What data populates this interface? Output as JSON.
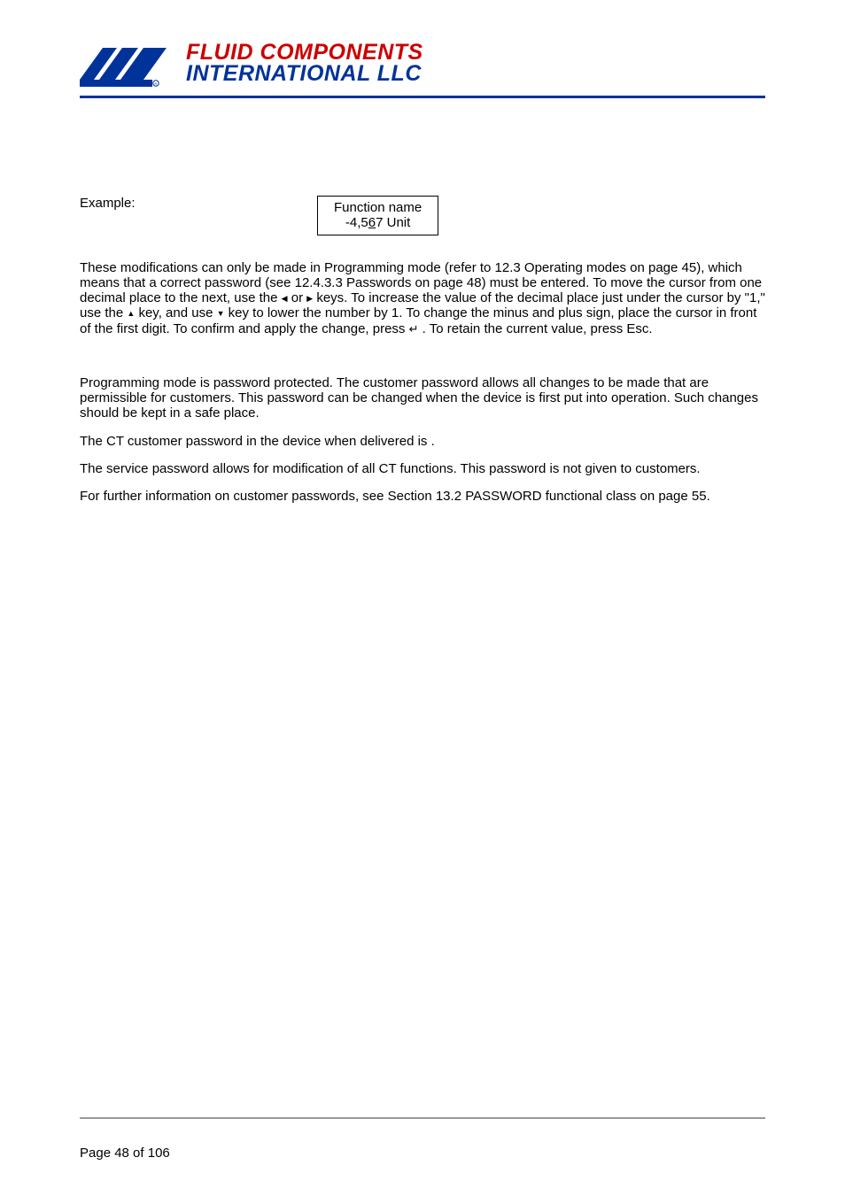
{
  "logo": {
    "line1": "FLUID COMPONENTS",
    "line2": "INTERNATIONAL LLC"
  },
  "example_label": "Example:",
  "box": {
    "line1": "Function name",
    "prefix": "-4,5",
    "under": "6",
    "suffix": "7 Unit"
  },
  "p1a": "These modifications can only be made in Programming mode (refer to 12.3 Operating modes on page 45), which means that a correct password (see 12.4.3.3 Passwords on page 48) must be entered. To move the cursor from one decimal place to the next, use the ",
  "p1b": " or ",
  "p1c": " keys. To increase the value of the decimal place just under the cursor by \"1,\" use the ",
  "p1d": " key, and use ",
  "p1e": " key to lower the number by 1. To change the minus and plus sign, place the cursor in front of the first digit. To confirm and apply the change, press ",
  "p1f": " . To retain the current value, press Esc.",
  "p2": "Programming mode is password protected. The customer password allows all changes to be made that are permissible for customers. This password can be changed when the device is first put into operation. Such changes should be kept in a safe place.",
  "p3": "The CT customer password in the device when delivered is        .",
  "p4": "The service password allows for modification of all CT functions. This password is not given to customers.",
  "p5": "For further information on customer passwords, see Section 13.2 PASSWORD functional class on page 55.",
  "footer": "Page 48 of 106",
  "glyph": {
    "left": "◀",
    "right": "▶",
    "up": "▲",
    "down": "▼",
    "enter": "↵"
  }
}
